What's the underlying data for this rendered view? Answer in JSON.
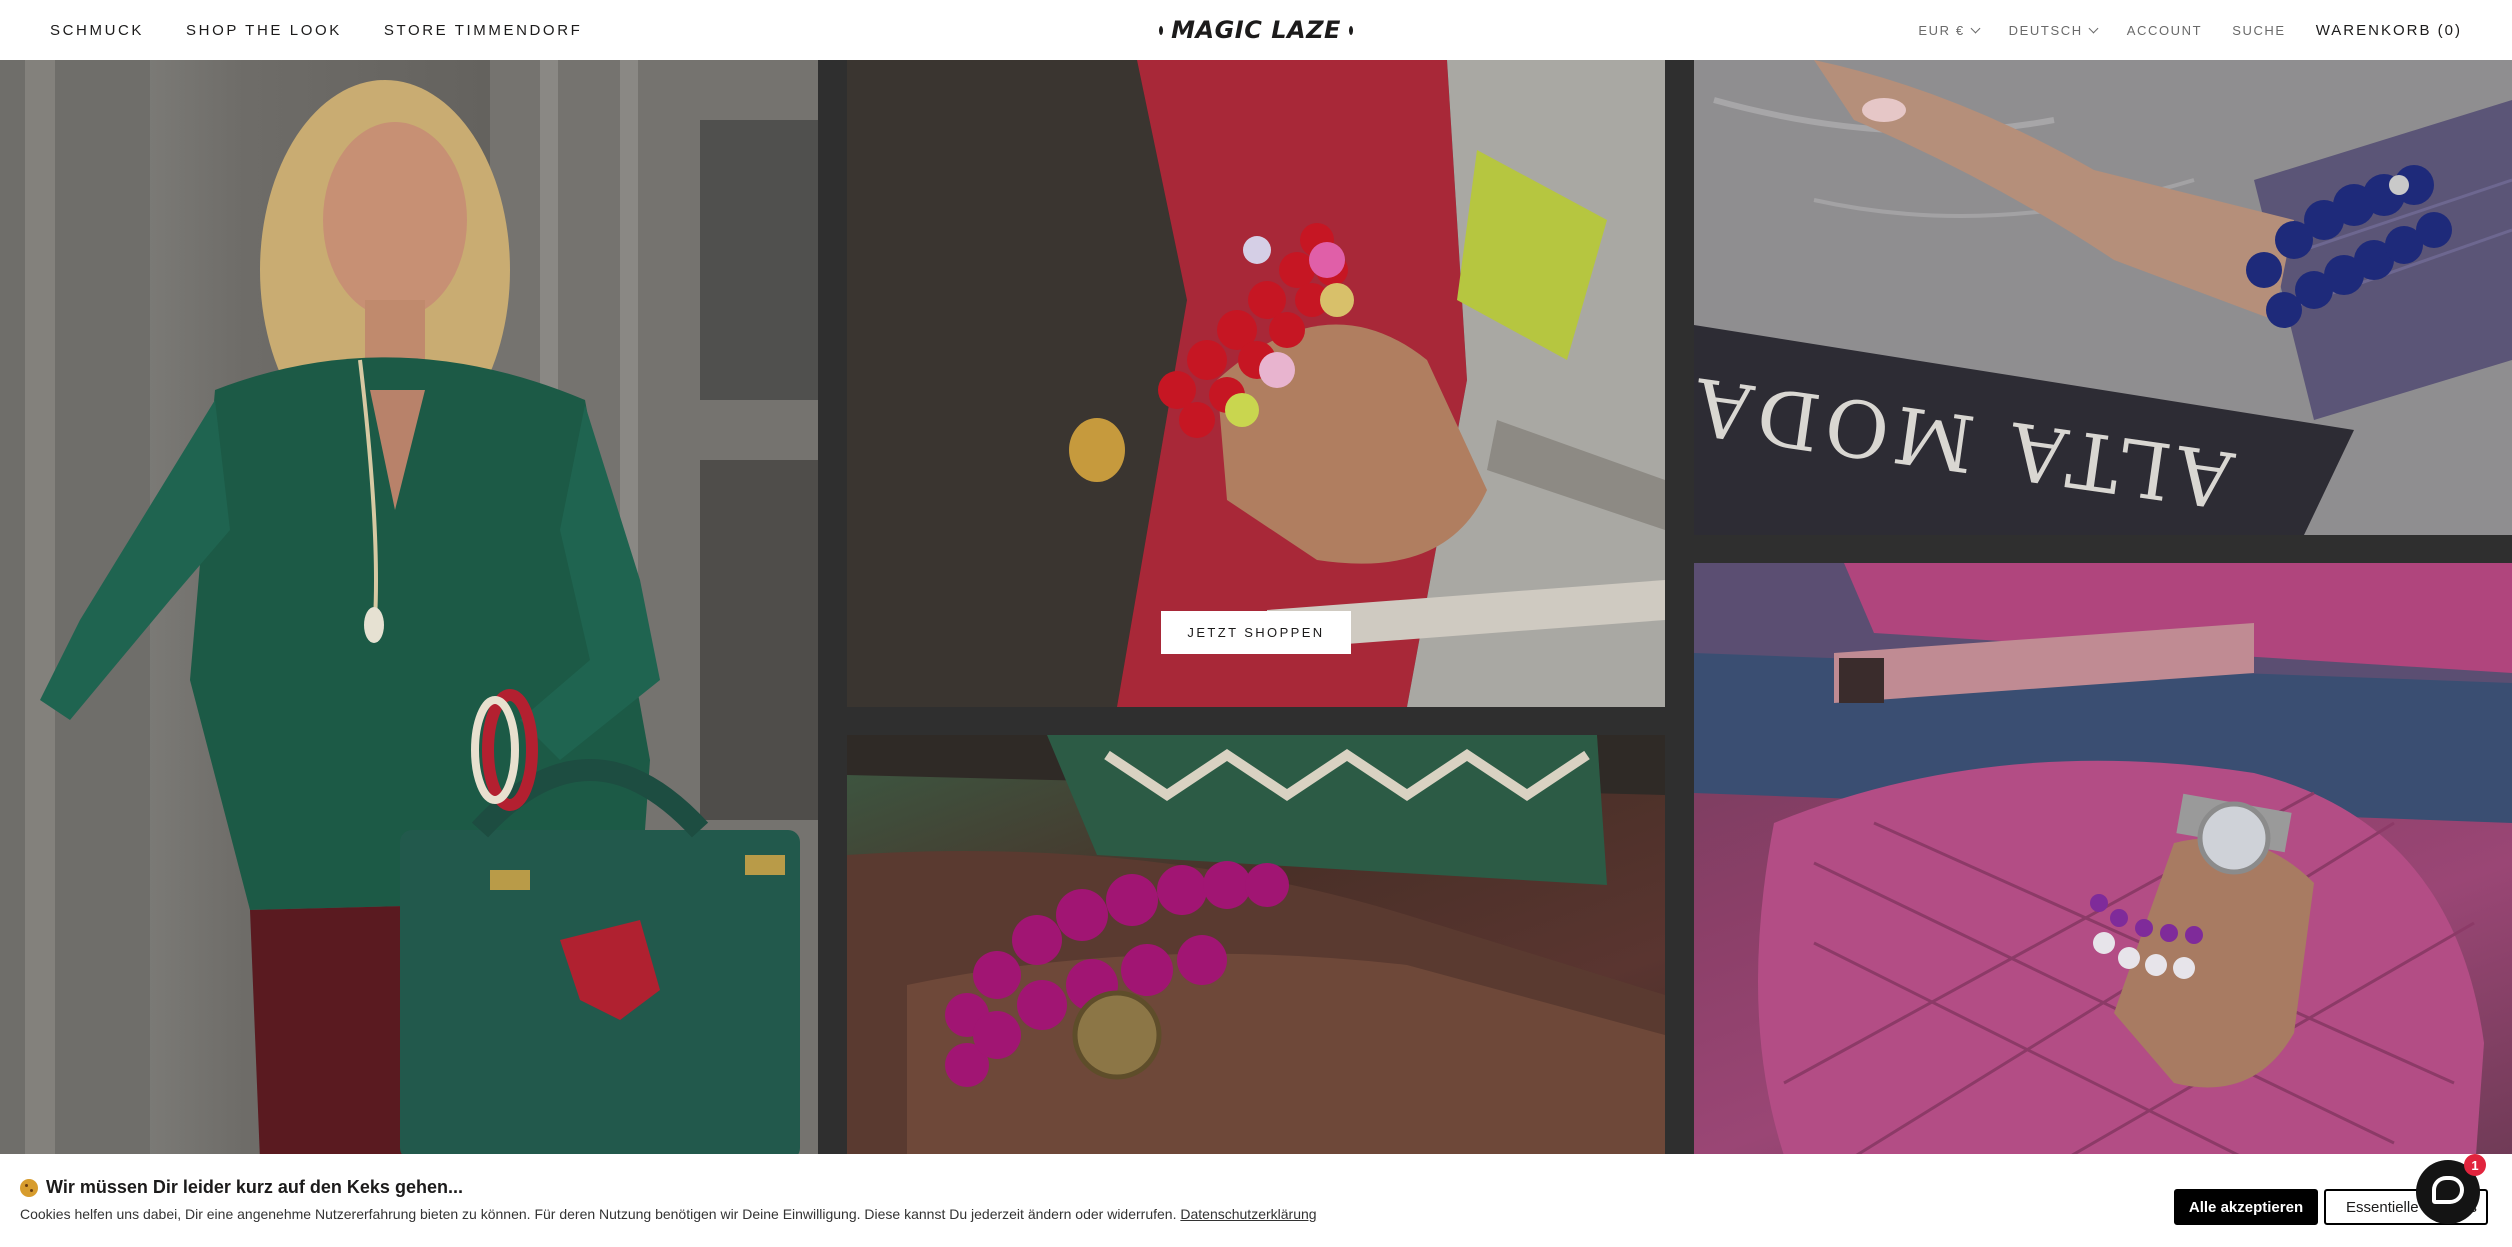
{
  "header": {
    "nav_left": [
      "SCHMUCK",
      "SHOP THE LOOK",
      "STORE TIMMENDORF"
    ],
    "logo": "MAGIC LAZE",
    "currency": "EUR €",
    "language": "DEUTSCH",
    "account": "ACCOUNT",
    "search": "SUCHE",
    "cart": "WARENKORB (0)"
  },
  "hero": {
    "cta": "JETZT SHOPPEN",
    "tiles": [
      {
        "name": "woman-green-blouse"
      },
      {
        "name": "red-bracelets"
      },
      {
        "name": "blue-bracelets",
        "magazine_text": "ALTA MODA"
      },
      {
        "name": "purple-bracelets"
      },
      {
        "name": "pink-bag-bracelets"
      }
    ]
  },
  "cookie": {
    "title": "Wir müssen Dir leider kurz auf den Keks gehen...",
    "text": "Cookies helfen uns dabei, Dir eine angenehme Nutzererfahrung bieten zu können. Für deren Nutzung benötigen wir Deine Einwilligung. Diese kannst Du jederzeit ändern oder widerrufen.",
    "link": "Datenschutzerklärung",
    "accept_all": "Alle akzeptieren",
    "essential_only": "Essentielle Cookies"
  },
  "chat": {
    "badge": "1"
  },
  "colors": {
    "accent_black": "#000000",
    "badge_red": "#e1243d",
    "background": "#ffffff"
  }
}
